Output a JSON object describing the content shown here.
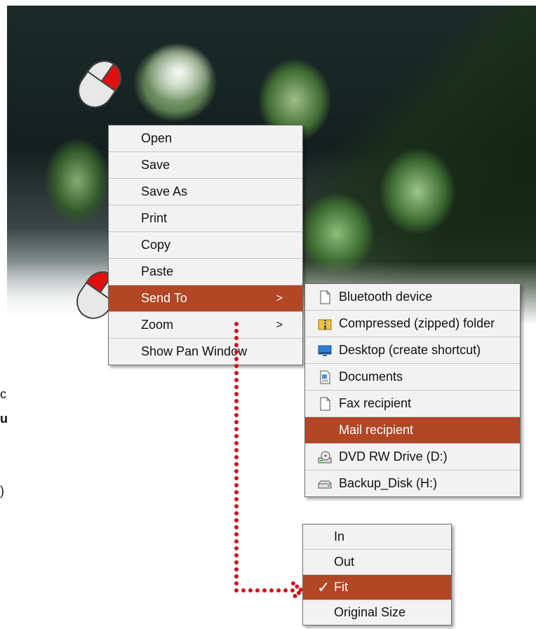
{
  "main_menu": {
    "items": [
      {
        "label": "Open",
        "arrow": ""
      },
      {
        "label": "Save",
        "arrow": ""
      },
      {
        "label": "Save As",
        "arrow": ""
      },
      {
        "label": "Print",
        "arrow": ""
      },
      {
        "label": "Copy",
        "arrow": ""
      },
      {
        "label": "Paste",
        "arrow": ""
      },
      {
        "label": "Send To",
        "arrow": ">"
      },
      {
        "label": "Zoom",
        "arrow": ">"
      },
      {
        "label": "Show Pan Window",
        "arrow": ""
      }
    ],
    "active_item": "Send To"
  },
  "send_to_menu": {
    "items": [
      {
        "label": "Bluetooth device",
        "icon": "blank-document-icon"
      },
      {
        "label": "Compressed (zipped) folder",
        "icon": "zip-folder-icon"
      },
      {
        "label": "Desktop (create shortcut)",
        "icon": "desktop-icon"
      },
      {
        "label": "Documents",
        "icon": "documents-icon"
      },
      {
        "label": "Fax recipient",
        "icon": "blank-document-icon"
      },
      {
        "label": "Mail recipient",
        "icon": ""
      },
      {
        "label": "DVD RW Drive (D:)",
        "icon": "dvd-drive-icon"
      },
      {
        "label": "Backup_Disk (H:)",
        "icon": "hard-drive-icon"
      }
    ],
    "active_item": "Mail recipient"
  },
  "zoom_menu": {
    "items": [
      {
        "label": "In",
        "check": ""
      },
      {
        "label": "Out",
        "check": ""
      },
      {
        "label": "Fit",
        "check": "✓"
      },
      {
        "label": "Original Size",
        "check": ""
      }
    ],
    "active_item": "Fit"
  },
  "side_text": {
    "line1": "c",
    "line2": "u",
    "line3": ")"
  },
  "colors": {
    "highlight": "#b24625",
    "menu_bg": "#f2f2f2",
    "dotted_arrow": "#d0101a",
    "mouse_button": "#e01010"
  }
}
